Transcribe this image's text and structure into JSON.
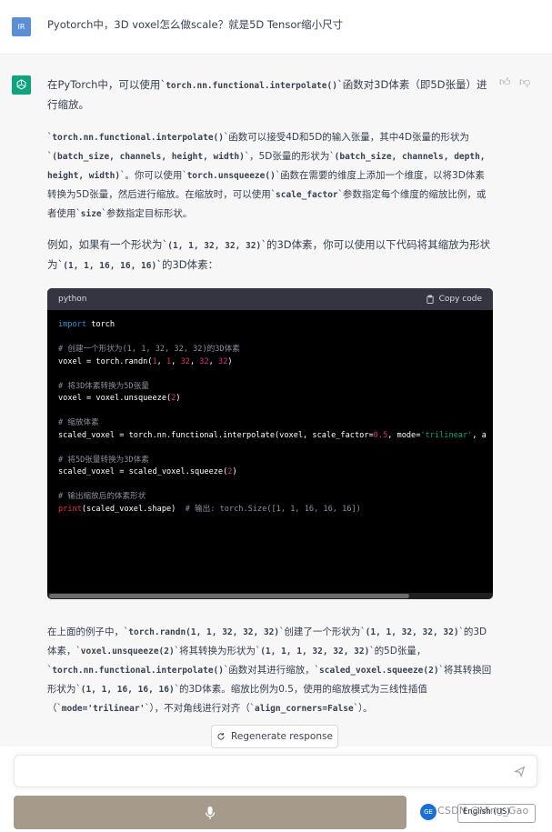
{
  "user_message": {
    "avatar_initials": "IR",
    "text": "Pyotorch中，3D voxel怎么做scale？就是5D Tensor缩小尺寸"
  },
  "assistant_message": {
    "avatar_icon": "openai-logo-icon",
    "p1": "在PyTorch中，可以使用`<code>torch.nn.functional.interpolate()</code>`函数对3D体素（即5D张量）进行缩放。",
    "p2": "`<code>torch.nn.functional.interpolate()</code>`函数可以接受4D和5D的输入张量，其中4D张量的形状为`<code>(batch_size, channels, height, width)</code>`，5D张量的形状为`<code>(batch_size, channels, depth, height, width)</code>`。你可以使用`<code>torch.unsqueeze()</code>`函数在需要的维度上添加一个维度，以将3D体素转换为5D张量，然后进行缩放。在缩放时，可以使用`<code>scale_factor</code>`参数指定每个维度的缩放比例，或者使用`<code>size</code>`参数指定目标形状。",
    "p3": "例如，如果有一个形状为`<code>(1, 1, 32, 32, 32)</code>`的3D体素，你可以使用以下代码将其缩放为形状为`<code>(1, 1, 16, 16, 16)</code>`的3D体素：",
    "code": {
      "language": "python",
      "copy_label": "Copy code",
      "lines": [
        "<span class=\"kw\">import</span> torch",
        "",
        "<span class=\"cm\"># 创建一个形状为(1, 1, 32, 32, 32)的3D体素</span>",
        "voxel = torch.randn(<span class=\"num\">1</span>, <span class=\"num\">1</span>, <span class=\"num\">32</span>, <span class=\"num\">32</span>, <span class=\"num\">32</span>)",
        "",
        "<span class=\"cm\"># 将3D体素转换为5D张量</span>",
        "voxel = voxel.unsqueeze(<span class=\"num\">2</span>)",
        "",
        "<span class=\"cm\"># 缩放体素</span>",
        "scaled_voxel = torch.nn.functional.interpolate(voxel, scale_factor=<span class=\"num\">0.5</span>, mode=<span class=\"str\">'trilinear'</span>, a",
        "",
        "<span class=\"cm\"># 将5D张量转换为3D体素</span>",
        "scaled_voxel = scaled_voxel.squeeze(<span class=\"num\">2</span>)",
        "",
        "<span class=\"cm\"># 输出缩放后的体素形状</span>",
        "<span class=\"fn\">print</span>(scaled_voxel.shape)  <span class=\"cm\"># 输出: torch.Size([1, 1, 16, 16, 16])</span>"
      ]
    },
    "p5": "在上面的例子中，`<code>torch.randn(1, 1, 32, 32, 32)</code>`创建了一个形状为`<code>(1, 1, 32, 32, 32)</code>`的3D体素，`<code>voxel.unsqueeze(2)</code>`将其转换为形状为`<code>(1, 1, 1, 32, 32, 32)</code>`的5D张量，`<code>torch.nn.functional.interpolate()</code>`函数对其进行缩放，`<code>scaled_voxel.squeeze(2)</code>`将其转换回形状为`<code>(1, 1, 16, 16, 16)</code>`的3D体素。缩放比例为0.5，使用的缩放模式为三线性插值（`<code>mode='trilinear'</code>`），不对角线进行对齐（`<code>align_corners=False</code>`）。"
  },
  "regenerate_label": "Regenerate response",
  "input": {
    "placeholder": ""
  },
  "language_select": {
    "value": "English (US)"
  },
  "lang_logo_text": "GE",
  "watermark": "CSDN @Ving_Gao",
  "colors": {
    "accent": "#10a37f",
    "voice_bar": "#a69a8a",
    "code_bg": "#000000"
  }
}
